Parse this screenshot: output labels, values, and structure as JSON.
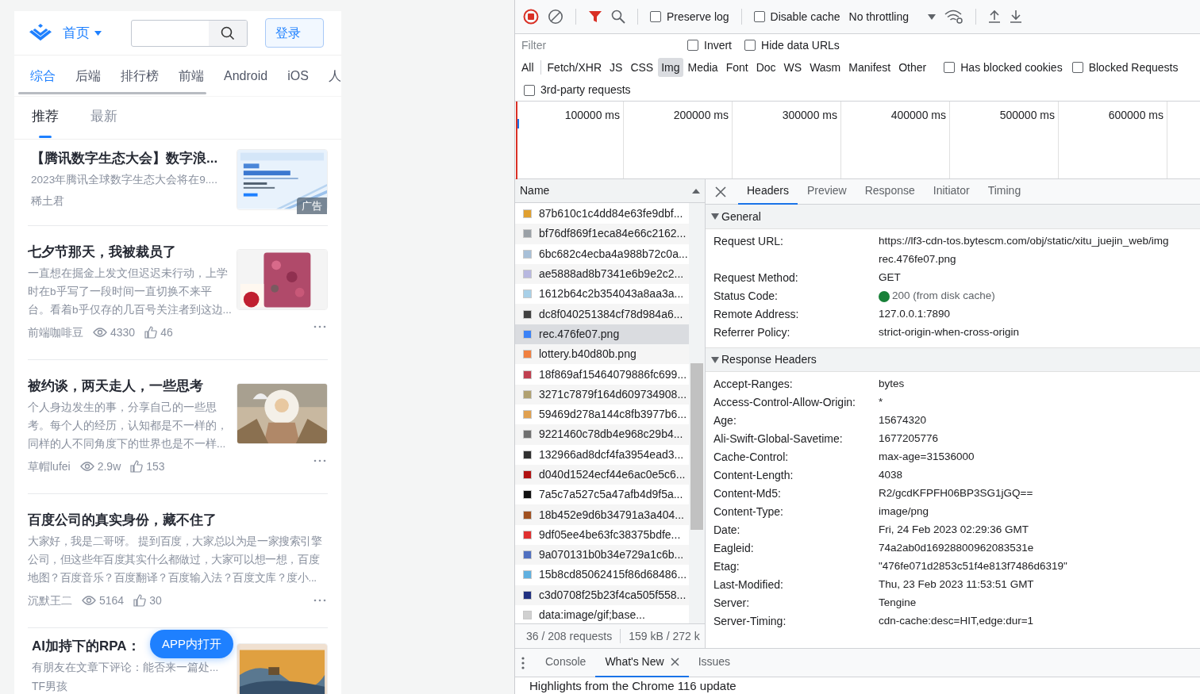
{
  "mobile_page": {
    "header": {
      "nav_label": "首页",
      "login_button": "登录"
    },
    "categories": [
      {
        "label": "综合",
        "selected": true
      },
      {
        "label": "后端",
        "selected": false
      },
      {
        "label": "排行榜",
        "selected": false
      },
      {
        "label": "前端",
        "selected": false
      },
      {
        "label": "Android",
        "selected": false
      },
      {
        "label": "iOS",
        "selected": false
      },
      {
        "label": "人",
        "selected": false
      }
    ],
    "subtabs": [
      {
        "label": "推荐",
        "selected": true
      },
      {
        "label": "最新",
        "selected": false
      }
    ],
    "articles": [
      {
        "kind": "ad",
        "title": "【腾讯数字生态大会】数字浪...",
        "summary": "2023年腾讯全球数字生态大会将在9....",
        "author": "稀土君",
        "badge": "广告"
      },
      {
        "kind": "post",
        "title": "七夕节那天，我被裁员了",
        "summary": "一直想在掘金上发文但迟迟未行动，上学时在b乎写了一段时间一直切换不来平台。看着b乎仅存的几百号关注者到这边...",
        "author": "前端咖啡豆",
        "views": "4330",
        "likes": "46"
      },
      {
        "kind": "post",
        "title": "被约谈，两天走人，一些思考",
        "summary": "个人身边发生的事，分享自己的一些思考。每个人的经历，认知都是不一样的，同样的人不同角度下的世界也是不一样...",
        "author": "草帽lufei",
        "views": "2.9w",
        "likes": "153"
      },
      {
        "kind": "text",
        "title": "百度公司的真实身份，藏不住了",
        "summary": "大家好，我是二哥呀。 提到百度，大家总以为是一家搜索引擎公司，但这些年百度其实什么都做过，大家可以想一想，百度地图？百度音乐？百度翻译？百度输入法？百度文库？度小...",
        "author": "沉默王二",
        "views": "5164",
        "likes": "30"
      },
      {
        "kind": "partial",
        "title": "AI加持下的RPA：",
        "summary": "有朋友在文章下评论：能否来一篇处...",
        "author": "TF男孩"
      }
    ],
    "open_app_button": "APP内打开"
  },
  "devtools": {
    "toolbar": {
      "recording": true,
      "preserve_log": {
        "label": "Preserve log",
        "checked": false
      },
      "disable_cache": {
        "label": "Disable cache",
        "checked": false
      },
      "throttling": "No throttling"
    },
    "filter": {
      "placeholder": "Filter",
      "options": [
        {
          "label": "Invert",
          "checked": false
        },
        {
          "label": "Hide data URLs",
          "checked": false
        }
      ]
    },
    "types": [
      {
        "label": "All",
        "selected": false
      },
      {
        "label": "Fetch/XHR",
        "selected": false
      },
      {
        "label": "JS",
        "selected": false
      },
      {
        "label": "CSS",
        "selected": false
      },
      {
        "label": "Img",
        "selected": true
      },
      {
        "label": "Media",
        "selected": false
      },
      {
        "label": "Font",
        "selected": false
      },
      {
        "label": "Doc",
        "selected": false
      },
      {
        "label": "WS",
        "selected": false
      },
      {
        "label": "Wasm",
        "selected": false
      },
      {
        "label": "Manifest",
        "selected": false
      },
      {
        "label": "Other",
        "selected": false
      }
    ],
    "type_options": [
      {
        "label": "Has blocked cookies",
        "checked": false
      },
      {
        "label": "Blocked Requests",
        "checked": false
      },
      {
        "label": "3rd-party requests",
        "checked": false
      }
    ],
    "timeline_ticks": [
      "100000 ms",
      "200000 ms",
      "300000 ms",
      "400000 ms",
      "500000 ms",
      "600000 ms"
    ],
    "requests": {
      "column": "Name",
      "rows": [
        {
          "name": "87b610c1c4dd84e63fe9dbf...",
          "color": "#e0a030",
          "selected": false
        },
        {
          "name": "bf76df869f1eca84e66c2162...",
          "color": "#9aa0a6",
          "selected": false
        },
        {
          "name": "6bc682c4ecba4a988b72c0a...",
          "color": "#a8c0d8",
          "selected": false
        },
        {
          "name": "ae5888ad8b7341e6b9e2c2...",
          "color": "#b8b8e0",
          "selected": false
        },
        {
          "name": "1612b64c2b354043a8aa3a...",
          "color": "#a8d0e8",
          "selected": false
        },
        {
          "name": "dc8f040251384cf78d984a6...",
          "color": "#404040",
          "selected": false
        },
        {
          "name": "rec.476fe07.png",
          "color": "#3b82f6",
          "selected": true
        },
        {
          "name": "lottery.b40d80b.png",
          "color": "#f08040",
          "selected": false
        },
        {
          "name": "18f869af15464079886fc699...",
          "color": "#c04050",
          "selected": false
        },
        {
          "name": "3271c7879f164d609734908...",
          "color": "#b0a070",
          "selected": false
        },
        {
          "name": "59469d278a144c8fb3977b6...",
          "color": "#e0a050",
          "selected": false
        },
        {
          "name": "9221460c78db4e968c29b4...",
          "color": "#707070",
          "selected": false
        },
        {
          "name": "132966ad8dcf4fa3954ead3...",
          "color": "#303030",
          "selected": false
        },
        {
          "name": "d040d1524ecf44e6ac0e5c6...",
          "color": "#b01010",
          "selected": false
        },
        {
          "name": "7a5c7a527c5a47afb4d9f5a...",
          "color": "#101010",
          "selected": false
        },
        {
          "name": "18b452e9d6b34791a3a404...",
          "color": "#a05020",
          "selected": false
        },
        {
          "name": "9df05ee4be63fc38375bdfe...",
          "color": "#e03030",
          "selected": false
        },
        {
          "name": "9a070131b0b34e729a1c6b...",
          "color": "#5070c0",
          "selected": false
        },
        {
          "name": "15b8cd85062415f86d68486...",
          "color": "#60b0e0",
          "selected": false
        },
        {
          "name": "c3d0708f25b23f4ca505f558...",
          "color": "#203080",
          "selected": false
        },
        {
          "name": "data:image/gif;base...",
          "color": "#d0d0d0",
          "selected": false
        }
      ]
    },
    "summary": [
      "36 / 208 requests",
      "159 kB / 272 k"
    ],
    "detail_tabs": [
      {
        "label": "Headers",
        "selected": true
      },
      {
        "label": "Preview",
        "selected": false
      },
      {
        "label": "Response",
        "selected": false
      },
      {
        "label": "Initiator",
        "selected": false
      },
      {
        "label": "Timing",
        "selected": false
      }
    ],
    "sections": [
      {
        "title": "General",
        "expanded": true,
        "rows": [
          {
            "label": "Request URL:",
            "value_lines": [
              "https://lf3-cdn-tos.bytescm.com/obj/static/xitu_juejin_web/img",
              "rec.476fe07.png"
            ]
          },
          {
            "label": "Request Method:",
            "value_lines": [
              "GET"
            ]
          },
          {
            "label": "Status Code:",
            "value_lines": [
              "200 (from disk cache)"
            ],
            "color": "#188038"
          },
          {
            "label": "Remote Address:",
            "value_lines": [
              "127.0.0.1:7890"
            ]
          },
          {
            "label": "Referrer Policy:",
            "value_lines": [
              "strict-origin-when-cross-origin"
            ]
          }
        ]
      },
      {
        "title": "Response Headers",
        "expanded": true,
        "rows": [
          {
            "label": "Accept-Ranges:",
            "value_lines": [
              "bytes"
            ]
          },
          {
            "label": "Access-Control-Allow-Origin:",
            "value_lines": [
              "*"
            ]
          },
          {
            "label": "Age:",
            "value_lines": [
              "15674320"
            ]
          },
          {
            "label": "Ali-Swift-Global-Savetime:",
            "value_lines": [
              "1677205776"
            ]
          },
          {
            "label": "Cache-Control:",
            "value_lines": [
              "max-age=31536000"
            ]
          },
          {
            "label": "Content-Length:",
            "value_lines": [
              "4038"
            ]
          },
          {
            "label": "Content-Md5:",
            "value_lines": [
              "R2/gcdKFPFH06BP3SG1jGQ=="
            ]
          },
          {
            "label": "Content-Type:",
            "value_lines": [
              "image/png"
            ]
          },
          {
            "label": "Date:",
            "value_lines": [
              "Fri, 24 Feb 2023 02:29:36 GMT"
            ]
          },
          {
            "label": "Eagleid:",
            "value_lines": [
              "74a2ab0d16928800962083531e"
            ]
          },
          {
            "label": "Etag:",
            "value_lines": [
              "\"476fe071d2853c51f4e813f7486d6319\""
            ]
          },
          {
            "label": "Last-Modified:",
            "value_lines": [
              "Thu, 23 Feb 2023 11:53:51 GMT"
            ]
          },
          {
            "label": "Server:",
            "value_lines": [
              "Tengine"
            ]
          },
          {
            "label": "Server-Timing:",
            "value_lines": [
              "cdn-cache:desc=HIT,edge:dur=1"
            ]
          }
        ]
      }
    ],
    "drawer": {
      "tabs": [
        {
          "label": "Console",
          "selected": false,
          "closable": false
        },
        {
          "label": "What's New",
          "selected": true,
          "closable": true
        },
        {
          "label": "Issues",
          "selected": false,
          "closable": false
        }
      ],
      "content": "Highlights from the Chrome 116 update"
    }
  }
}
